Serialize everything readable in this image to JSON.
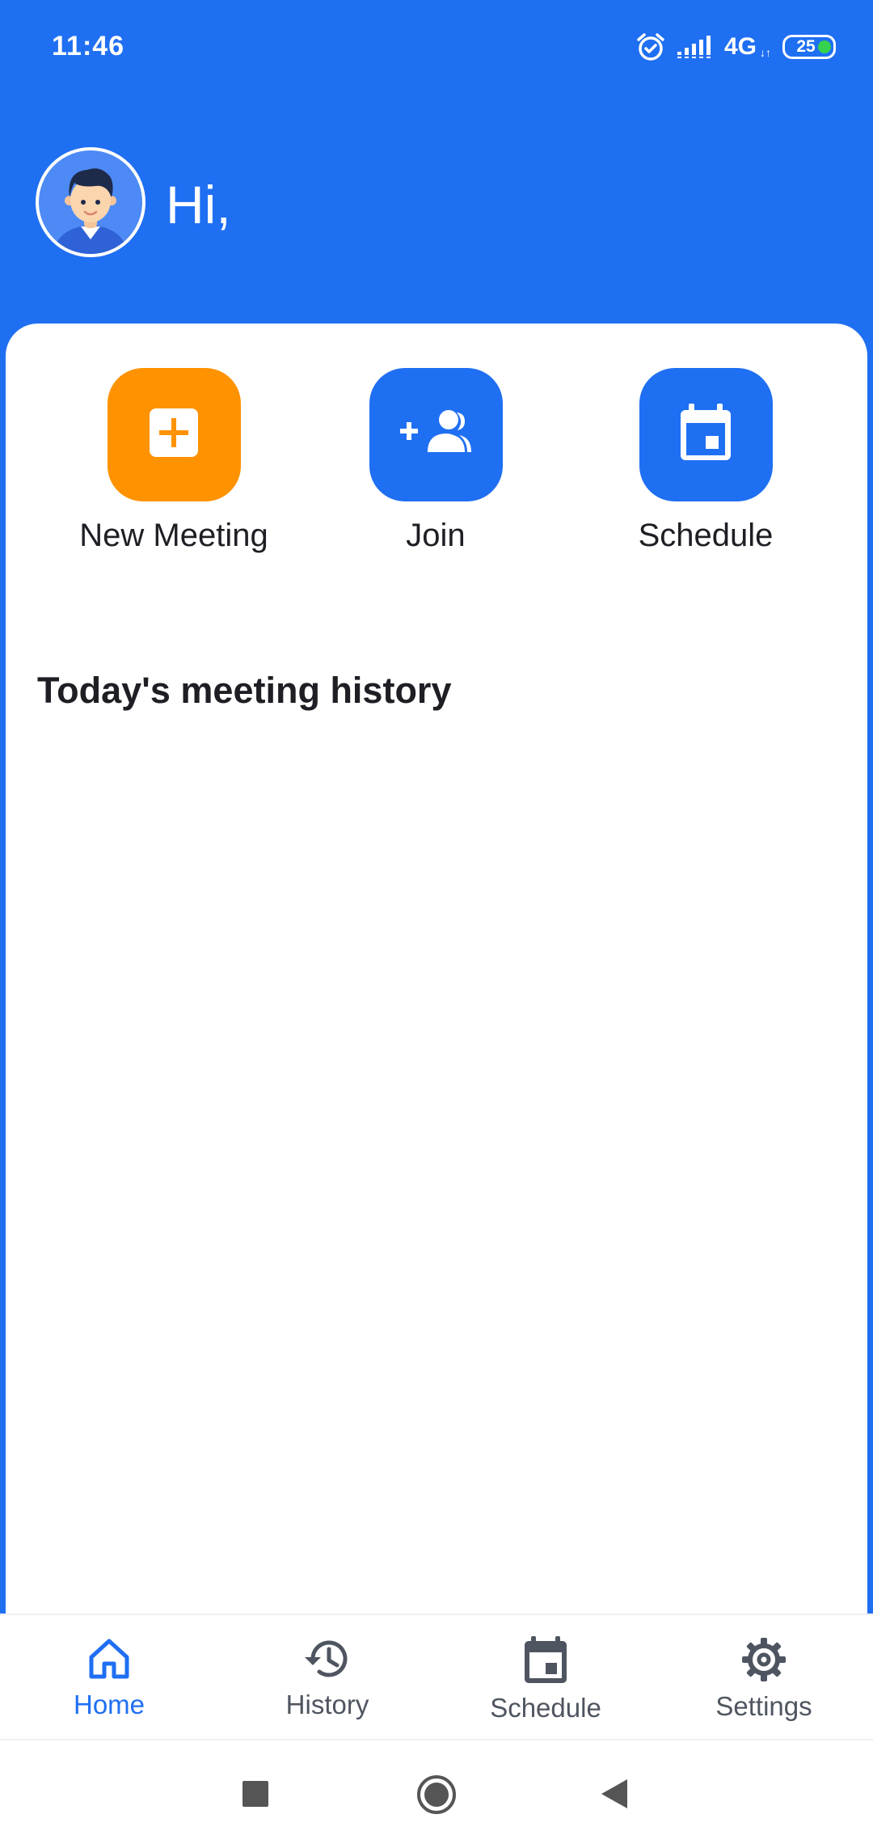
{
  "status_bar": {
    "time": "11:46",
    "network": "4G",
    "network_arrows": "↓↑",
    "battery": "25",
    "icons": [
      "alarm-icon",
      "signal-icon",
      "battery-icon"
    ]
  },
  "header": {
    "greeting": "Hi,",
    "avatar_icon": "user-avatar"
  },
  "actions": [
    {
      "label": "New Meeting",
      "icon": "plus-box-icon",
      "color": "#fe9200"
    },
    {
      "label": "Join",
      "icon": "add-people-icon",
      "color": "#1f6ff2"
    },
    {
      "label": "Schedule",
      "icon": "calendar-icon",
      "color": "#1f6ff2"
    }
  ],
  "section": {
    "title": "Today's meeting history"
  },
  "bottom_nav": {
    "items": [
      {
        "label": "Home",
        "icon": "home-icon",
        "active": true
      },
      {
        "label": "History",
        "icon": "history-icon",
        "active": false
      },
      {
        "label": "Schedule",
        "icon": "calendar-icon",
        "active": false
      },
      {
        "label": "Settings",
        "icon": "gear-icon",
        "active": false
      }
    ]
  },
  "system_nav": {
    "buttons": [
      "recents-button",
      "home-button",
      "back-button"
    ]
  },
  "colors": {
    "primary": "#1f6ff2",
    "accent": "#fe9200",
    "text": "#1e1e24",
    "nav_inactive": "#4f5560"
  }
}
